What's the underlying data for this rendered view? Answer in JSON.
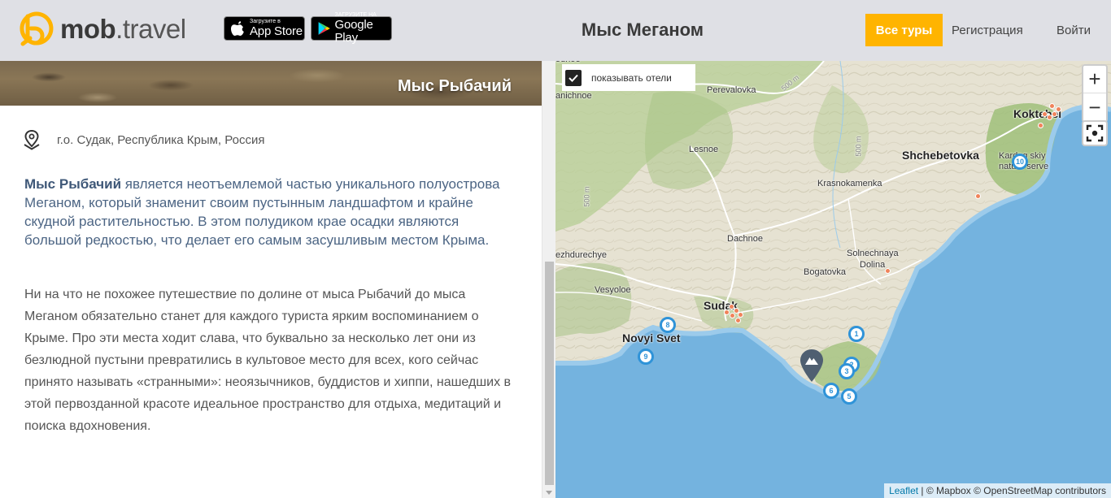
{
  "header": {
    "logo": {
      "bold": "mob",
      "light": ".travel"
    },
    "appstore": {
      "small": "Загрузите в",
      "big": "App Store"
    },
    "googleplay": {
      "small": "ЗАГРУЗИТЕ НА",
      "big": "Google Play"
    },
    "title": "Мыс Меганом",
    "tours_label": "Все туры",
    "register_label": "Регистрация",
    "login_label": "Войти",
    "accent_color": "#ffb400"
  },
  "content": {
    "hero_title": "Мыс Рыбачий",
    "location": "г.о. Судак, Республика Крым, Россия",
    "lead_bold": "Мыс Рыбачий",
    "lead_rest": " является неотъемлемой частью уникального полуострова Меганом, который знаменит своим пустынным ландшафтом и крайне скудной растительностью. В этом полудиком крае осадки являются большой редкостью, что делает его самым засушливым местом Крыма.",
    "body": "Ни на что не похожее путешествие по долине от мыса Рыбачий до мыса Меганом обязательно станет для каждого туриста ярким воспоминанием о Крыме. Про эти места ходит слава, что буквально за несколько лет они из безлюдной пустыни превратились в культовое место для всех, кого сейчас принято называть «странными»: неоязычников, буддистов и хиппи, нашедших в этой первозданной красоте идеальное пространство для отдыха, медитаций и поиска вдохновения."
  },
  "map": {
    "show_hotels_label": "показывать отели",
    "show_hotels_checked": true,
    "zoom_in": "+",
    "zoom_out": "−",
    "attribution_leaflet": "Leaflet",
    "attribution_rest": " | © Mapbox © OpenStreetMap contributors",
    "places": {
      "edge_top": "odnoe",
      "edge_left_1": "anichnoe",
      "perevalovka": "Perevalovka",
      "lesnoe": "Lesnoe",
      "krasnokamenka": "Krasnokamenka",
      "shchebetovka": "Shchebetovka",
      "koktebel": "Koktebel",
      "karadag": "Kardag skiy nature serve",
      "dachnoe": "Dachnoe",
      "mezhdurechye": "ezhdurechye",
      "solnechnaya": "Solnechnaya",
      "dolina": "Dolina",
      "bogatovka": "Bogatovka",
      "vesyoloe": "Vesyoloe",
      "sudak": "Sudak",
      "novyi_svet": "Novyi Svet",
      "elev_1": "500 m",
      "elev_2": "500 m",
      "elev_3": "500 m"
    },
    "markers": [
      "10",
      "8",
      "9",
      "1",
      "2",
      "3",
      "6",
      "5"
    ]
  }
}
